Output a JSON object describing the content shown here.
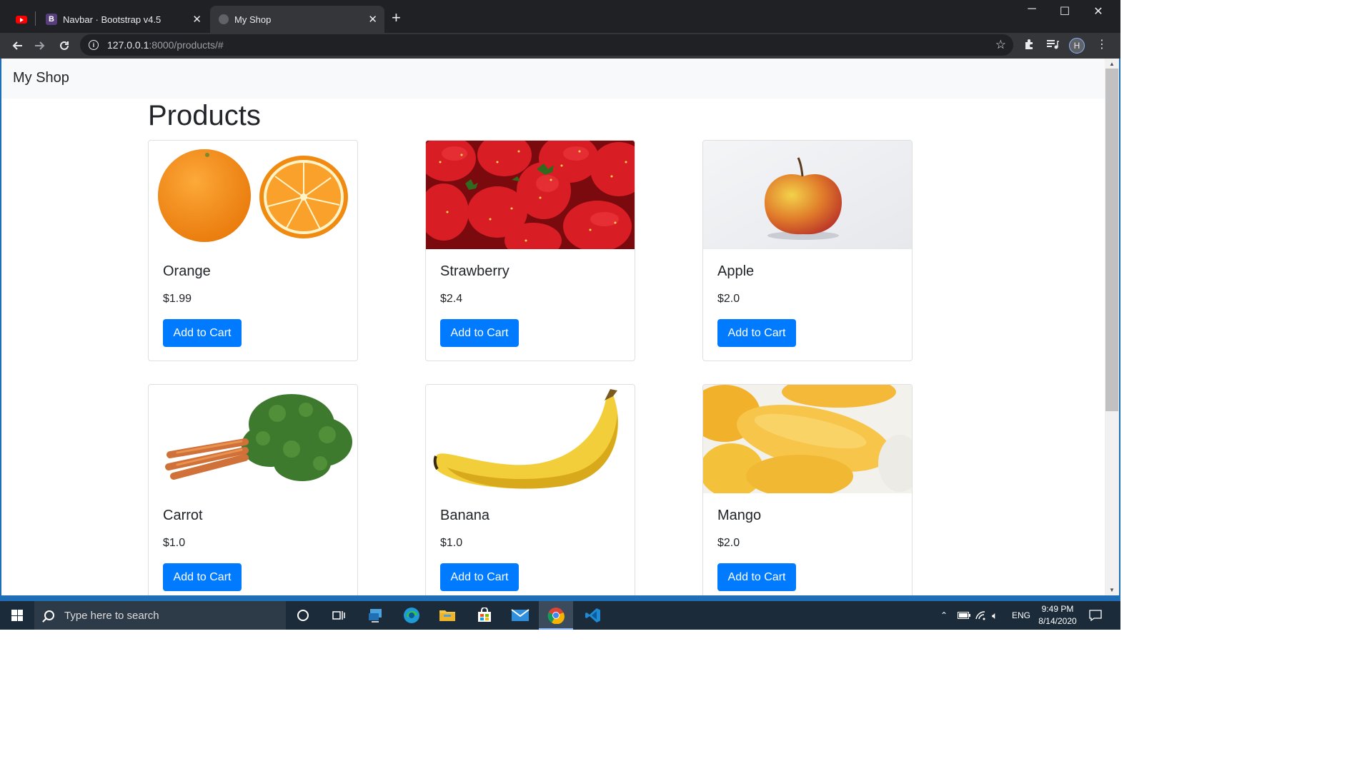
{
  "browser": {
    "tabs": [
      {
        "title": "",
        "icon": "youtube-icon",
        "active": false
      },
      {
        "title": "Navbar · Bootstrap v4.5",
        "icon": "bootstrap-icon",
        "active": false
      },
      {
        "title": "My Shop",
        "icon": "globe-icon",
        "active": true
      }
    ],
    "url_host": "127.0.0.1",
    "url_rest": ":8000/products/#",
    "profile_initial": "H"
  },
  "site": {
    "brand": "My Shop",
    "heading": "Products",
    "button_label": "Add to Cart",
    "primary_color": "#007bff",
    "products": [
      {
        "name": "Orange",
        "price": "$1.99",
        "image": "orange"
      },
      {
        "name": "Strawberry",
        "price": "$2.4",
        "image": "strawberry"
      },
      {
        "name": "Apple",
        "price": "$2.0",
        "image": "apple"
      },
      {
        "name": "Carrot",
        "price": "$1.0",
        "image": "carrot"
      },
      {
        "name": "Banana",
        "price": "$1.0",
        "image": "banana"
      },
      {
        "name": "Mango",
        "price": "$2.0",
        "image": "mango"
      }
    ]
  },
  "taskbar": {
    "search_placeholder": "Type here to search",
    "pinned": [
      "cortana-icon",
      "task-view-icon",
      "remote-desktop-icon",
      "edge-icon",
      "file-explorer-icon",
      "store-icon",
      "mail-icon",
      "chrome-icon",
      "vscode-icon"
    ],
    "language": "ENG",
    "time": "9:49 PM",
    "date": "8/14/2020"
  }
}
